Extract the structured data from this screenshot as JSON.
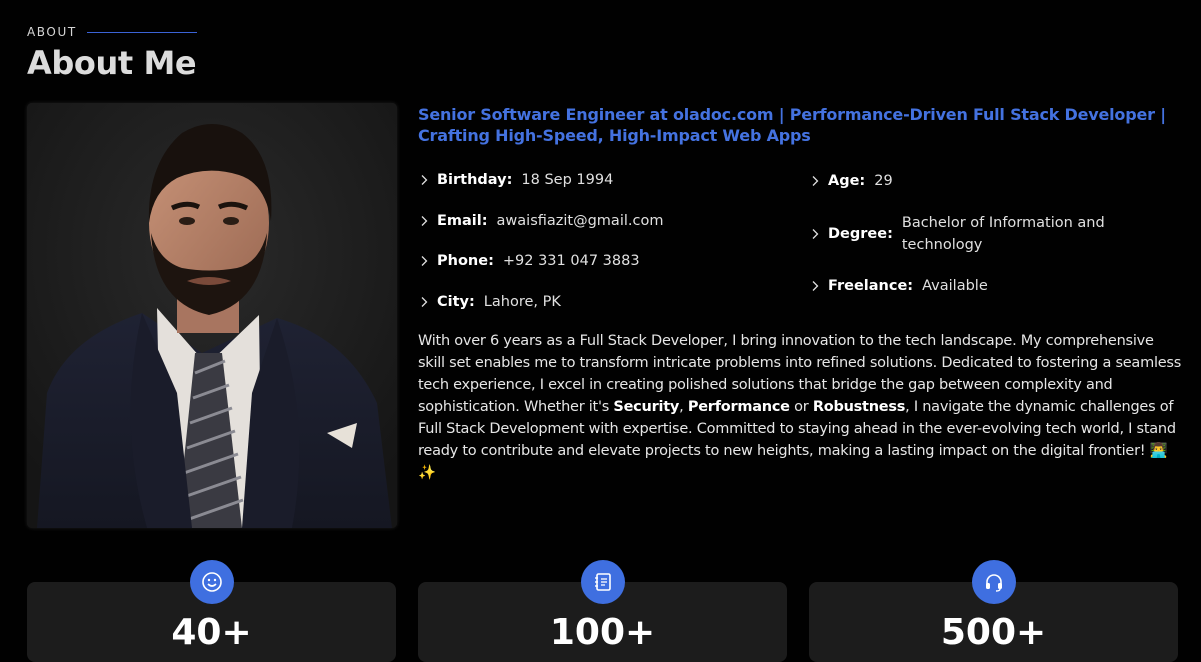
{
  "section": {
    "label": "ABOUT",
    "title": "About Me"
  },
  "headline": "Senior Software Engineer at oladoc.com | Performance-Driven Full Stack Developer | Crafting High-Speed, High-Impact Web Apps",
  "info_left": [
    {
      "key": "Birthday:",
      "value": "18 Sep 1994"
    },
    {
      "key": "Email:",
      "value": "awaisfiazit@gmail.com"
    },
    {
      "key": "Phone:",
      "value": "+92 331 047 3883"
    },
    {
      "key": "City:",
      "value": "Lahore, PK"
    }
  ],
  "info_right": [
    {
      "key": "Age:",
      "value": "29"
    },
    {
      "key": "Degree:",
      "value": "Bachelor of Information and technology"
    },
    {
      "key": "Freelance:",
      "value": "Available"
    }
  ],
  "bio": {
    "part1": "With over 6 years as a Full Stack Developer, I bring innovation to the tech landscape. My comprehensive skill set enables me to transform intricate problems into refined solutions. Dedicated to fostering a seamless tech experience, I excel in creating polished solutions that bridge the gap between complexity and sophistication. Whether it's ",
    "em1": "Security",
    "sep1": ", ",
    "em2": "Performance",
    "sep2": " or ",
    "em3": "Robustness",
    "part2": ", I navigate the dynamic challenges of Full Stack Development with expertise. Committed to staying ahead in the ever-evolving tech world, I stand ready to contribute and elevate projects to new heights, making a lasting impact on the digital frontier! 👨‍💻✨"
  },
  "stats": [
    {
      "icon": "smiley-icon",
      "value": "40+"
    },
    {
      "icon": "journal-icon",
      "value": "100+"
    },
    {
      "icon": "headset-icon",
      "value": "500+"
    }
  ],
  "colors": {
    "accent": "#4472e0",
    "background": "#010101",
    "card": "#1c1c1c"
  }
}
